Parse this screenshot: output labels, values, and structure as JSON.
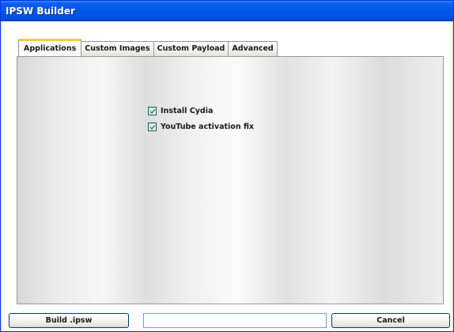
{
  "window": {
    "title": "IPSW Builder"
  },
  "tabs": [
    {
      "label": "Applications",
      "active": true
    },
    {
      "label": "Custom Images",
      "active": false
    },
    {
      "label": "Custom Payload",
      "active": false
    },
    {
      "label": "Advanced",
      "active": false
    }
  ],
  "applications": {
    "options": [
      {
        "label": "Install Cydia",
        "checked": true
      },
      {
        "label": "YouTube activation fix",
        "checked": true
      }
    ]
  },
  "bottom": {
    "build_label": "Build .ipsw",
    "status_value": "",
    "cancel_label": "Cancel"
  },
  "colors": {
    "titlebar": "#0058e6",
    "active_tab_accent": "#ffc83c",
    "checkmark": "#21a121"
  }
}
